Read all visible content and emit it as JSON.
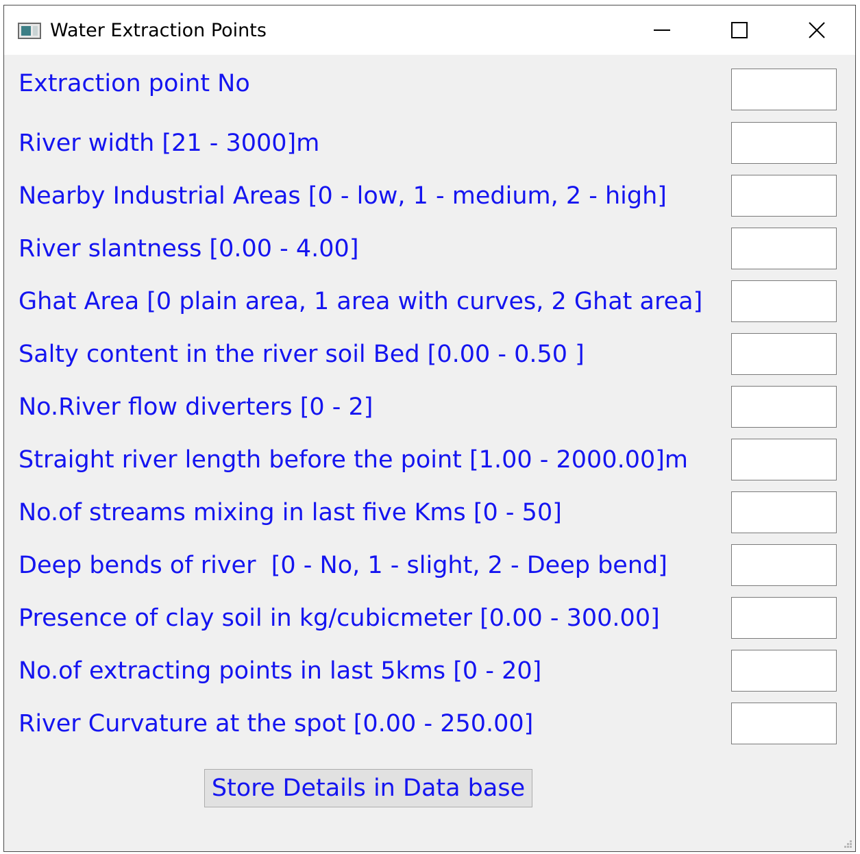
{
  "window": {
    "title": "Water Extraction Points",
    "icon": "app-window-icon",
    "controls": [
      "minimize-icon",
      "maximize-icon",
      "close-icon"
    ]
  },
  "form": {
    "fields": [
      {
        "label": "Extraction point No",
        "value": ""
      },
      {
        "label": "River width [21 - 3000]m",
        "value": ""
      },
      {
        "label": "Nearby Industrial Areas [0 - low, 1 - medium, 2 - high]",
        "value": ""
      },
      {
        "label": "River slantness [0.00 - 4.00]",
        "value": ""
      },
      {
        "label": "Ghat Area [0 plain area, 1 area with curves, 2 Ghat area]",
        "value": ""
      },
      {
        "label": "Salty content in the river soil Bed [0.00 - 0.50 ]",
        "value": ""
      },
      {
        "label": "No.River flow diverters [0 - 2]",
        "value": ""
      },
      {
        "label": "Straight river length before the point [1.00 - 2000.00]m",
        "value": ""
      },
      {
        "label": "No.of streams mixing in last five Kms [0 - 50]",
        "value": ""
      },
      {
        "label": "Deep bends of river  [0 - No, 1 - slight, 2 - Deep bend]",
        "value": ""
      },
      {
        "label": "Presence of clay soil in kg/cubicmeter [0.00 - 300.00]",
        "value": ""
      },
      {
        "label": "No.of extracting points in last 5kms [0 - 20]",
        "value": ""
      },
      {
        "label": "River Curvature at the spot [0.00 - 250.00]",
        "value": ""
      }
    ],
    "submit_label": "Store Details in Data base"
  },
  "colors": {
    "label_text": "#1414f0",
    "client_background": "#f0f0f0",
    "button_background": "#e1e1e1"
  }
}
